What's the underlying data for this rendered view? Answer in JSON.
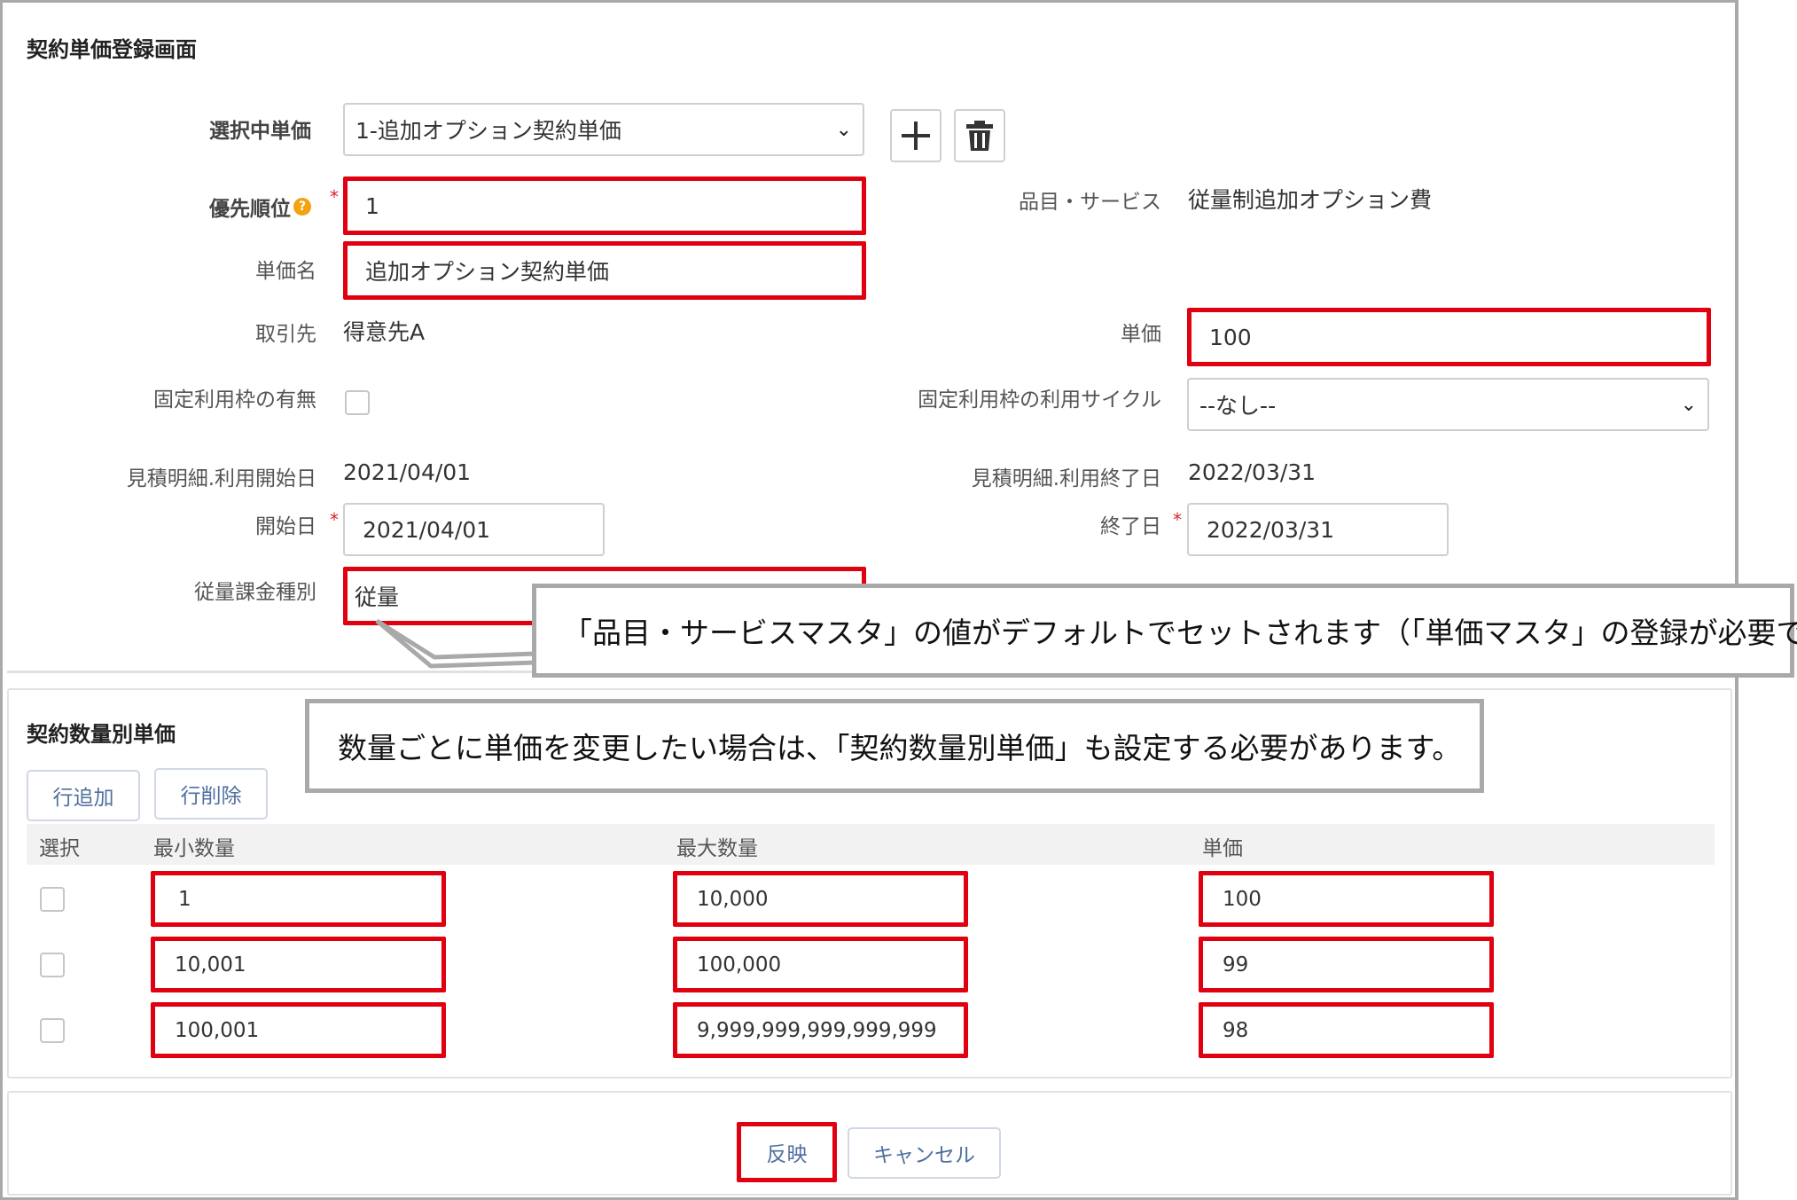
{
  "form": {
    "title": "契約単価登録画面",
    "selected": {
      "label": "選択中単価",
      "value": "1-追加オプション契約単価"
    },
    "priority": {
      "label": "優先順位",
      "value": "1"
    },
    "name": {
      "label": "単価名",
      "value": "追加オプション契約単価"
    },
    "customer": {
      "label": "取引先",
      "value": "得意先A"
    },
    "fixed_usage": {
      "label": "固定利用枠の有無",
      "checked": false
    },
    "est_start": {
      "label": "見積明細.利用開始日",
      "value": "2021/04/01"
    },
    "start": {
      "label": "開始日",
      "value": "2021/04/01"
    },
    "billing": {
      "label": "従量課金種別",
      "value": "従量"
    },
    "item": {
      "label": "品目・サービス",
      "value": "従量制追加オプション費"
    },
    "unit_price": {
      "label": "単価",
      "value": "100"
    },
    "cycle": {
      "label": "固定利用枠の利用サイクル",
      "value": "--なし--"
    },
    "est_end": {
      "label": "見積明細.利用終了日",
      "value": "2022/03/31"
    },
    "end": {
      "label": "終了日",
      "value": "2022/03/31"
    },
    "required_mark": "*"
  },
  "quantity": {
    "title": "契約数量別単価",
    "add_row": "行追加",
    "delete_row": "行削除",
    "headers": {
      "select": "選択",
      "min": "最小数量",
      "max": "最大数量",
      "price": "単価"
    },
    "rows": [
      {
        "min": "1",
        "max": "10,000",
        "price": "100"
      },
      {
        "min": "10,001",
        "max": "100,000",
        "price": "99"
      },
      {
        "min": "100,001",
        "max": "9,999,999,999,999,999",
        "price": "98"
      }
    ]
  },
  "footer": {
    "apply": "反映",
    "cancel": "キャンセル"
  },
  "callouts": {
    "default_note": "「品目・サービスマスタ」の値がデフォルトでセットされます（「単価マスタ」の登録が必要です）。",
    "quantity_note": "数量ごとに単価を変更したい場合は、「契約数量別単価」も設定する必要があります。"
  },
  "colors": {
    "highlight": "#e0000f",
    "required": "#d9262b",
    "button_text": "#4f6f9e"
  },
  "icons": {
    "add": "plus-icon",
    "delete": "trash-icon",
    "help": "help-icon",
    "dropdown": "chevron-down-icon"
  }
}
